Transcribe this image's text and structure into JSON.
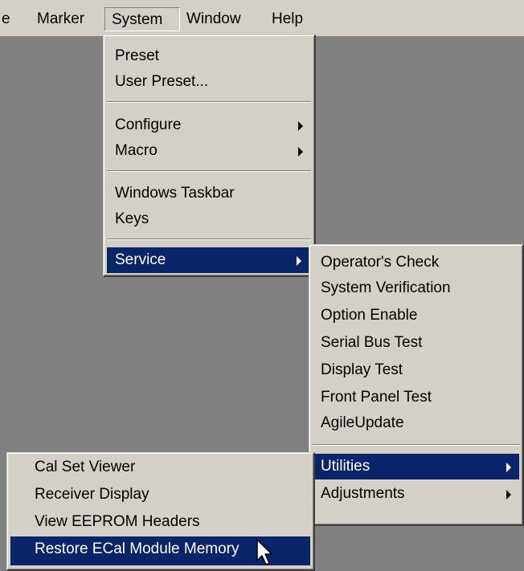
{
  "menubar": {
    "items": [
      {
        "label": "e"
      },
      {
        "label": "Marker"
      },
      {
        "label": "System"
      },
      {
        "label": "Window"
      },
      {
        "label": "Help"
      }
    ]
  },
  "system_menu": {
    "items": [
      {
        "label": "Preset"
      },
      {
        "label": "User Preset..."
      },
      {
        "label": "Configure"
      },
      {
        "label": "Macro"
      },
      {
        "label": "Windows Taskbar"
      },
      {
        "label": "Keys"
      },
      {
        "label": "Service"
      }
    ]
  },
  "service_menu": {
    "items": [
      {
        "label": "Operator's Check"
      },
      {
        "label": "System Verification"
      },
      {
        "label": "Option Enable"
      },
      {
        "label": "Serial Bus Test"
      },
      {
        "label": "Display Test"
      },
      {
        "label": "Front Panel Test"
      },
      {
        "label": "AgileUpdate"
      },
      {
        "label": "Utilities"
      },
      {
        "label": "Adjustments"
      }
    ]
  },
  "utilities_menu": {
    "items": [
      {
        "label": "Cal Set Viewer"
      },
      {
        "label": "Receiver Display"
      },
      {
        "label": "View EEPROM Headers"
      },
      {
        "label": "Restore ECal Module Memory"
      }
    ]
  },
  "colors": {
    "menu_face": "#d4d0c8",
    "highlight": "#0a246a",
    "desktop": "#808080"
  }
}
